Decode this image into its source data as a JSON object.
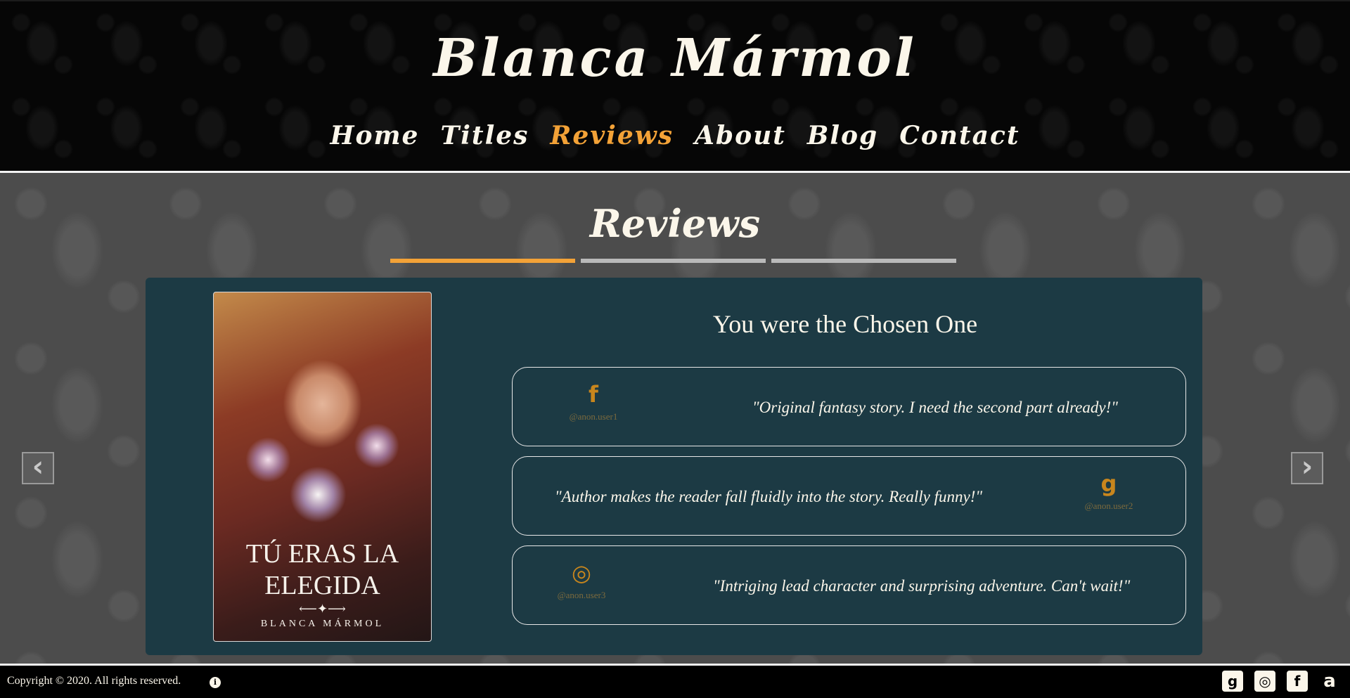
{
  "header": {
    "site_title": "Blanca Mármol",
    "nav": [
      "Home",
      "Titles",
      "Reviews",
      "About",
      "Blog",
      "Contact"
    ],
    "active_nav": "Reviews"
  },
  "main": {
    "section_title": "Reviews",
    "carousel": {
      "slide_count": 3,
      "active_index": 0,
      "prev_icon": "chevron-left-icon",
      "next_icon": "chevron-right-icon"
    },
    "book": {
      "title": "You were the Chosen One",
      "cover": {
        "title": "TÚ ERAS LA\nELEGIDA",
        "author": "BLANCA MÁRMOL"
      }
    },
    "reviews": [
      {
        "icon": "facebook-icon",
        "glyph": "f",
        "user": "@anon.user1",
        "quote": "\"Original fantasy story. I need the second part already!\""
      },
      {
        "icon": "goodreads-icon",
        "glyph": "g",
        "user": "@anon.user2",
        "quote": "\"Author makes the reader fall fluidly into the story. Really funny!\""
      },
      {
        "icon": "instagram-icon",
        "glyph": "◎",
        "user": "@anon.user3",
        "quote": "\"Intriging lead character and surprising adventure. Can't wait!\""
      }
    ]
  },
  "footer": {
    "copyright": "Copyright © 2020. All rights reserved.",
    "info_glyph": "i",
    "socials": [
      {
        "icon": "goodreads-icon",
        "glyph": "g"
      },
      {
        "icon": "instagram-icon",
        "glyph": "◎"
      },
      {
        "icon": "facebook-icon",
        "glyph": "f"
      },
      {
        "icon": "amazon-icon",
        "glyph": "a"
      }
    ]
  },
  "colors": {
    "accent": "#f3a237",
    "card_bg": "#1c3a44",
    "icon_gold": "#c8861d",
    "text_light": "#fbf6ea"
  }
}
